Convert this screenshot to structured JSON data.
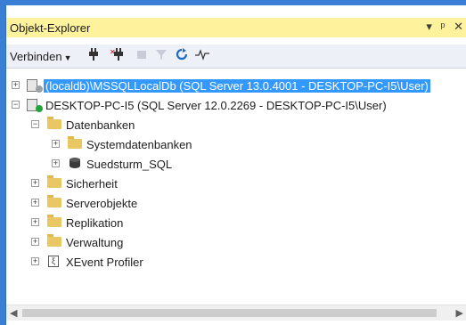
{
  "panel": {
    "title": "Objekt-Explorer",
    "controls": [
      "▾",
      "ᵖ",
      "✕"
    ]
  },
  "toolbar": {
    "connect_label": "Verbinden",
    "icons": [
      "connect-icon",
      "disconnect-icon",
      "stop-icon",
      "filter-icon",
      "refresh-icon",
      "activity-monitor-icon"
    ]
  },
  "tree": {
    "items": [
      {
        "label": "(localdb)\\MSSQLLocalDb (SQL Server 13.0.4001 - DESKTOP-PC-I5\\User)",
        "level": 0,
        "expanded": false,
        "icon": "server-icon",
        "selected": true
      },
      {
        "label": "DESKTOP-PC-I5 (SQL Server 12.0.2269 - DESKTOP-PC-I5\\User)",
        "level": 0,
        "expanded": true,
        "icon": "server-icon",
        "selected": false
      },
      {
        "label": "Datenbanken",
        "level": 1,
        "expanded": true,
        "icon": "folder-icon"
      },
      {
        "label": "Systemdatenbanken",
        "level": 2,
        "expanded": false,
        "icon": "folder-icon"
      },
      {
        "label": "Suedsturm_SQL",
        "level": 2,
        "expanded": false,
        "icon": "database-icon"
      },
      {
        "label": "Sicherheit",
        "level": 1,
        "expanded": false,
        "icon": "folder-icon"
      },
      {
        "label": "Serverobjekte",
        "level": 1,
        "expanded": false,
        "icon": "folder-icon"
      },
      {
        "label": "Replikation",
        "level": 1,
        "expanded": false,
        "icon": "folder-icon"
      },
      {
        "label": "Verwaltung",
        "level": 1,
        "expanded": false,
        "icon": "folder-icon"
      },
      {
        "label": "XEvent Profiler",
        "level": 1,
        "expanded": false,
        "icon": "xevent-icon"
      }
    ]
  },
  "colors": {
    "accent": "#3399ff",
    "titlebar": "#fff29d",
    "folder": "#e9c763"
  }
}
